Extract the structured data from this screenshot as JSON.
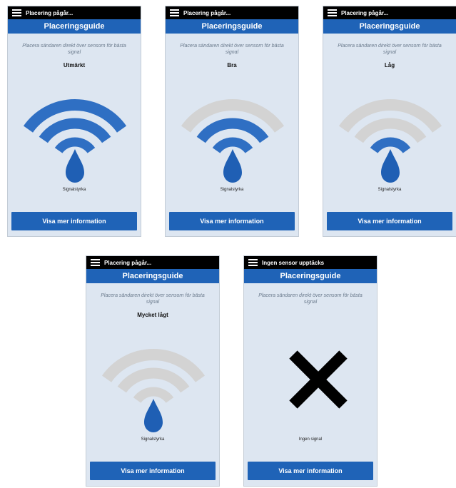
{
  "screens": [
    {
      "status": "Placering pågår...",
      "title": "Placeringsguide",
      "instruction": "Placera sändaren direkt över sensorn för bästa signal",
      "level": "Utmärkt",
      "active_arcs": 3,
      "caption": "Signalstyrka",
      "button": "Visa mer information"
    },
    {
      "status": "Placering pågår...",
      "title": "Placeringsguide",
      "instruction": "Placera sändaren direkt över sensorn för bästa signal",
      "level": "Bra",
      "active_arcs": 2,
      "caption": "Signalstyrka",
      "button": "Visa mer information"
    },
    {
      "status": "Placering pågår...",
      "title": "Placeringsguide",
      "instruction": "Placera sändaren direkt över sensorn för bästa signal",
      "level": "Låg",
      "active_arcs": 1,
      "caption": "Signalstyrka",
      "button": "Visa mer information"
    },
    {
      "status": "Placering pågår...",
      "title": "Placeringsguide",
      "instruction": "Placera sändaren direkt över sensorn för bästa signal",
      "level": "Mycket lågt",
      "active_arcs": 0,
      "caption": "Signalstyrka",
      "button": "Visa mer information"
    },
    {
      "status": "Ingen sensor upptäcks",
      "title": "Placeringsguide",
      "instruction": "Placera sändaren direkt över sensorn för bästa signal",
      "level": "",
      "active_arcs": 0,
      "caption": "Ingen signal",
      "button": "Visa mer information",
      "no_sensor": true
    }
  ],
  "colors": {
    "header": "#1f63b7",
    "screen_bg": "#dde6f1",
    "arc_active": "#2f6fc3",
    "arc_inactive": "#d3d3d3",
    "drop": "#1f5fb4",
    "cross": "#000000"
  }
}
